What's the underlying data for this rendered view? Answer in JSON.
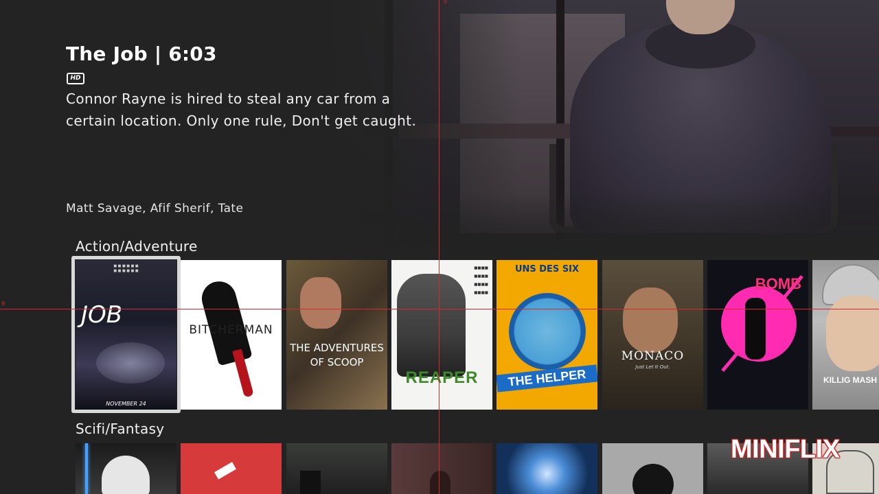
{
  "featured": {
    "title": "The Job | 6:03",
    "quality_badge": "HD",
    "synopsis": "Connor Rayne is hired to steal any car from a certain location. Only one rule, Don't get caught.",
    "cast": "Matt Savage, Afif Sherif, Tate"
  },
  "rows": [
    {
      "label": "Action/Adventure",
      "posters": [
        {
          "title": "JOB",
          "date": "NOVEMBER 24",
          "selected": true
        },
        {
          "title": "BITCHERMAN"
        },
        {
          "title": "THE ADVENTURES OF SCOOP"
        },
        {
          "title": "REAPER"
        },
        {
          "title": "THE HELPER",
          "header": "UNS DES SIX"
        },
        {
          "title": "MONACO",
          "tagline": "Just Let It Out."
        },
        {
          "title": "BOMB"
        },
        {
          "title": "KILLIG MASH"
        }
      ]
    },
    {
      "label": "Scifi/Fantasy",
      "posters": [
        {
          "title": ""
        },
        {
          "title": ""
        },
        {
          "title": ""
        },
        {
          "title": ""
        },
        {
          "title": ""
        },
        {
          "title": ""
        },
        {
          "title": ""
        },
        {
          "title": ""
        }
      ]
    }
  ],
  "brand": {
    "logo_text": "MINIFLIX",
    "logo_color": "#d21f1f"
  },
  "guides": {
    "top_marker": "0",
    "left_marker": "9",
    "color": "#d62a2a"
  }
}
